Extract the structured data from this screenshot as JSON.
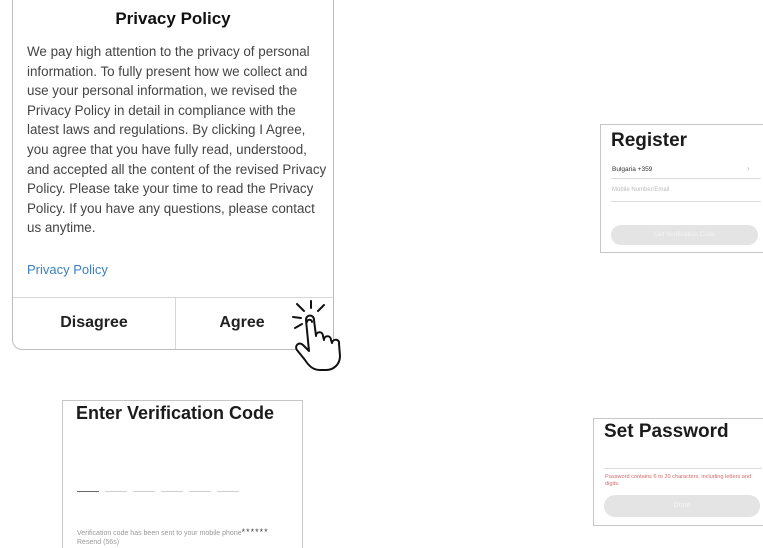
{
  "privacy_dialog": {
    "title": "Privacy Policy",
    "body": "We pay high attention to the privacy of personal information. To fully present how we collect and use your personal information, we revised the Privacy Policy in detail in compliance with the latest laws and regulations. By clicking I Agree, you agree that you have fully read, understood, and accepted all the content of the revised Privacy Policy. Please take your time to read the Privacy Policy. If you have any questions, please contact us anytime.",
    "link": "Privacy Policy",
    "disagree_label": "Disagree",
    "agree_label": "Agree"
  },
  "register": {
    "title": "Register",
    "country": "Bulgaria +359",
    "input_placeholder": "Mobile Number/Email",
    "button": "Get Verification Code"
  },
  "verification": {
    "title": "Enter Verification Code",
    "note": "Verification code has been sent to your mobile phone",
    "masked_number": "******",
    "resend": "Resend (56s)"
  },
  "set_password": {
    "title": "Set Password",
    "hint": "Password contains 6 to 20 characters, including letters and digits.",
    "button": "Done"
  },
  "colors": {
    "link": "#3b7fc4",
    "hint": "#d26a6a",
    "disabled_button": "#e4e4e4"
  }
}
